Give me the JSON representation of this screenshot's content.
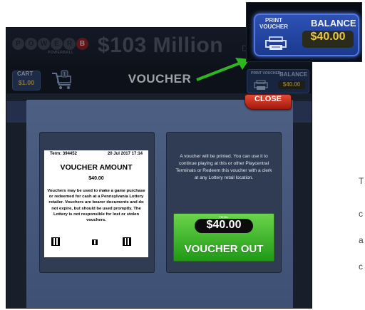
{
  "header": {
    "logo_balls": [
      "P",
      "O",
      "W",
      "E",
      "R",
      "B"
    ],
    "logo_subtitle": "POWERBALL",
    "jackpot": "$103 Million",
    "jackpot_suffix": "DI"
  },
  "cart": {
    "label": "CART",
    "amount": "$1.00",
    "count": "1"
  },
  "screen_title": "VOUCHER",
  "print_balance": {
    "print_label": "PRINT VOUCHER",
    "balance_label": "BALANCE",
    "amount": "$40.00"
  },
  "zoom_inset": {
    "print_label": "PRINT VOUCHER",
    "balance_label": "BALANCE",
    "amount": "$40.00"
  },
  "modal": {
    "close_label": "CLOSE",
    "receipt": {
      "term": "Term: 394452",
      "date": "20 Jul 2017 17:14",
      "title": "VOUCHER AMOUNT",
      "amount": "$40.00",
      "body": "Vouchers may be used to make a game purchase or redeemed for cash at a Pennsylvania Lottery retailer. Vouchers are bearer documents and do not expire, but should be used promptly. The Lottery is not responsible for lost or stolen vouchers."
    },
    "message": "A voucher will be printed. You can use it to continue playing at this or other Playcentral Terminals or Redeem this voucher with a clerk at any Lottery retail location.",
    "total_label": "TOTAL",
    "total_amount": "$40.00",
    "voucher_out_label": "VOUCHER OUT"
  },
  "edge_text": [
    "T",
    "c",
    "a",
    "c"
  ],
  "colors": {
    "accent_green": "#2fb51f",
    "close_red": "#c92a18",
    "balance_blue": "#2549a8",
    "amount_gold": "#e8c648"
  }
}
